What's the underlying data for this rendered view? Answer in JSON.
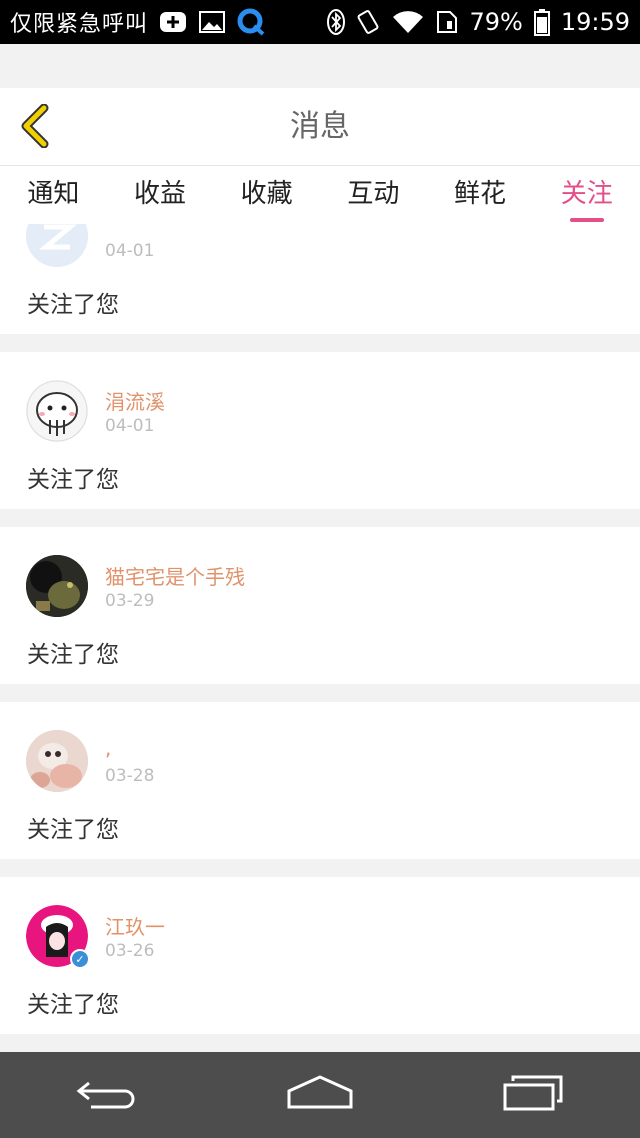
{
  "status_bar": {
    "carrier_text": "仅限紧急呼叫",
    "battery_percent": "79%",
    "time": "19:59",
    "icons": [
      "add-icon",
      "image-icon",
      "app-q-icon",
      "bluetooth-icon",
      "vibrate-icon",
      "wifi-icon",
      "sim-icon",
      "battery-icon"
    ]
  },
  "header": {
    "title": "消息",
    "back_icon": "chevron-left-icon",
    "accent_color": "#f0d000"
  },
  "tabs": [
    {
      "label": "通知",
      "active": false
    },
    {
      "label": "收益",
      "active": false
    },
    {
      "label": "收藏",
      "active": false
    },
    {
      "label": "互动",
      "active": false
    },
    {
      "label": "鲜花",
      "active": false
    },
    {
      "label": "关注",
      "active": true
    }
  ],
  "tab_active_color": "#e24f8b",
  "notifications": [
    {
      "user": "",
      "date": "04-01",
      "message": "关注了您",
      "avatar": "logo-avatar"
    },
    {
      "user": "涓流溪",
      "date": "04-01",
      "message": "关注了您",
      "avatar": "cartoon-avatar"
    },
    {
      "user": "猫宅宅是个手残",
      "date": "03-29",
      "message": "关注了您",
      "avatar": "dark-photo-avatar"
    },
    {
      "user": ",",
      "date": "03-28",
      "message": "关注了您",
      "avatar": "cat-photo-avatar"
    },
    {
      "user": "江玖一",
      "date": "03-26",
      "message": "关注了您",
      "avatar": "pink-anime-avatar",
      "verified": true
    }
  ],
  "nav_bar": [
    "back-nav-icon",
    "home-nav-icon",
    "recents-nav-icon"
  ]
}
